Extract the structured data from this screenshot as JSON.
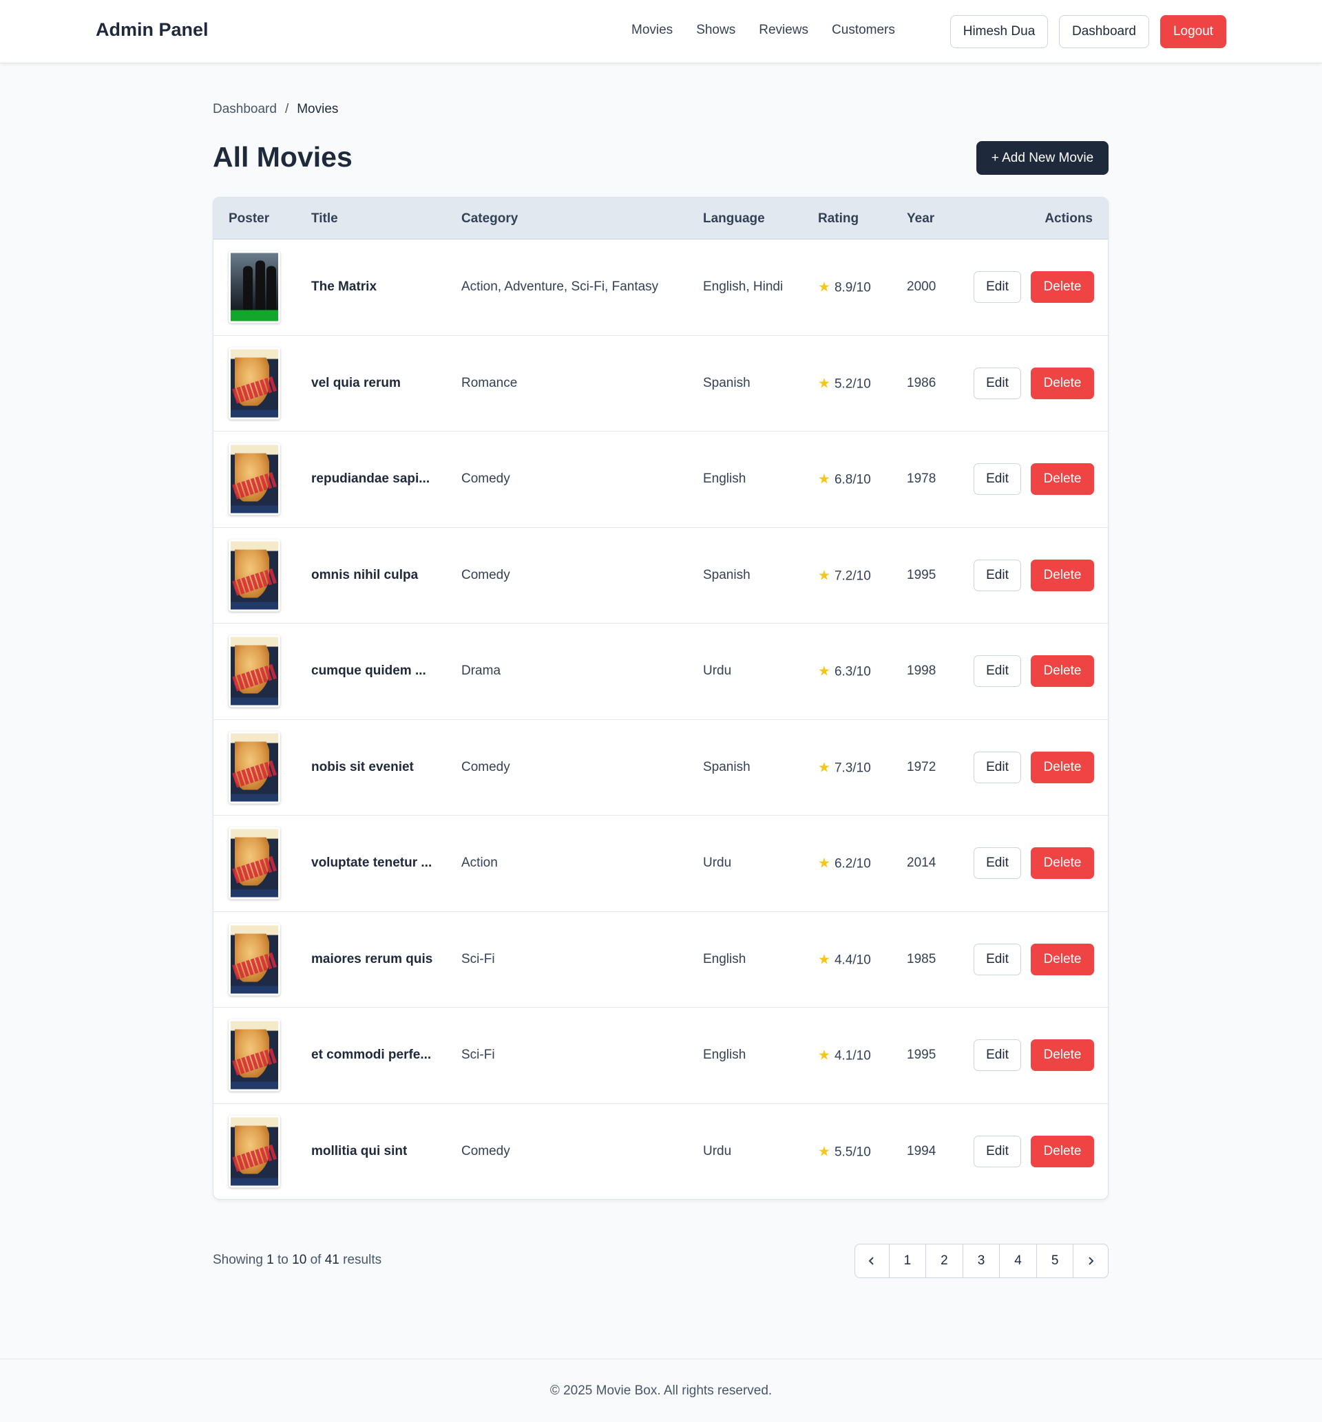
{
  "header": {
    "brand": "Admin Panel",
    "nav": [
      "Movies",
      "Shows",
      "Reviews",
      "Customers"
    ],
    "user_label": "Himesh Dua",
    "dashboard_label": "Dashboard",
    "logout_label": "Logout"
  },
  "breadcrumb": {
    "parent": "Dashboard",
    "separator": "/",
    "current": "Movies"
  },
  "page": {
    "title": "All Movies",
    "add_label": "+ Add New Movie"
  },
  "table": {
    "columns": [
      "Poster",
      "Title",
      "Category",
      "Language",
      "Rating",
      "Year",
      "Actions"
    ],
    "edit_label": "Edit",
    "delete_label": "Delete",
    "rows": [
      {
        "poster": "matrix",
        "title": "The Matrix",
        "category": "Action, Adventure, Sci-Fi, Fantasy",
        "language": "English, Hindi",
        "rating": "8.9/10",
        "year": "2000"
      },
      {
        "poster": "this-gun-for-hire",
        "title": "vel quia rerum",
        "category": "Romance",
        "language": "Spanish",
        "rating": "5.2/10",
        "year": "1986"
      },
      {
        "poster": "this-gun-for-hire",
        "title": "repudiandae sapi...",
        "category": "Comedy",
        "language": "English",
        "rating": "6.8/10",
        "year": "1978"
      },
      {
        "poster": "this-gun-for-hire",
        "title": "omnis nihil culpa",
        "category": "Comedy",
        "language": "Spanish",
        "rating": "7.2/10",
        "year": "1995"
      },
      {
        "poster": "this-gun-for-hire",
        "title": "cumque quidem ...",
        "category": "Drama",
        "language": "Urdu",
        "rating": "6.3/10",
        "year": "1998"
      },
      {
        "poster": "this-gun-for-hire",
        "title": "nobis sit eveniet",
        "category": "Comedy",
        "language": "Spanish",
        "rating": "7.3/10",
        "year": "1972"
      },
      {
        "poster": "this-gun-for-hire",
        "title": "voluptate tenetur ...",
        "category": "Action",
        "language": "Urdu",
        "rating": "6.2/10",
        "year": "2014"
      },
      {
        "poster": "this-gun-for-hire",
        "title": "maiores rerum quis",
        "category": "Sci-Fi",
        "language": "English",
        "rating": "4.4/10",
        "year": "1985"
      },
      {
        "poster": "this-gun-for-hire",
        "title": "et commodi perfe...",
        "category": "Sci-Fi",
        "language": "English",
        "rating": "4.1/10",
        "year": "1995"
      },
      {
        "poster": "this-gun-for-hire",
        "title": "mollitia qui sint",
        "category": "Comedy",
        "language": "Urdu",
        "rating": "5.5/10",
        "year": "1994"
      }
    ]
  },
  "pagination": {
    "showing_prefix": "Showing",
    "from": "1",
    "to_word": "to",
    "to": "10",
    "of_word": "of",
    "total": "41",
    "suffix": "results",
    "pages": [
      "1",
      "2",
      "3",
      "4",
      "5"
    ],
    "prev_icon": "chevron-left-icon",
    "next_icon": "chevron-right-icon"
  },
  "footer": {
    "text": "© 2025 Movie Box. All rights reserved."
  },
  "colors": {
    "primary_dark": "#1e293b",
    "danger": "#ef4444",
    "star": "#f5c518"
  }
}
